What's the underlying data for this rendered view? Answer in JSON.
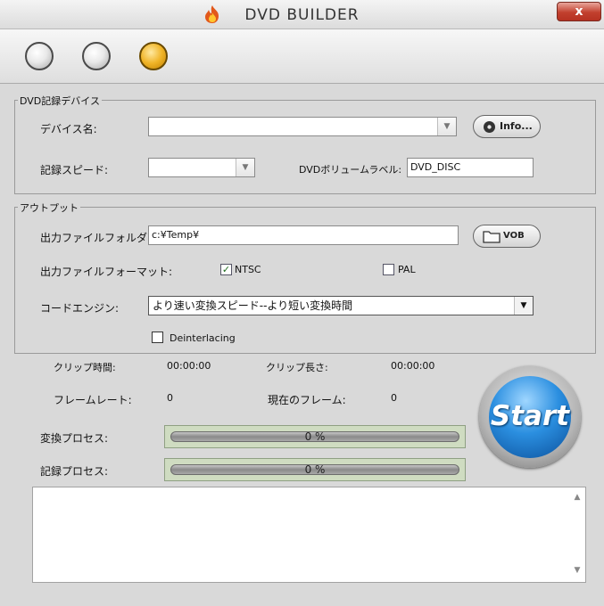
{
  "window": {
    "title": "DVD BUILDER",
    "close_label": "x"
  },
  "toolbar": {
    "circles": [
      {
        "state": "inactive"
      },
      {
        "state": "inactive"
      },
      {
        "state": "active"
      }
    ]
  },
  "dvd_device": {
    "group_label": "DVD記録デバイス",
    "device_name_label": "デバイス名:",
    "device_name_value": "",
    "info_button_label": "Info...",
    "record_speed_label": "記録スピード:",
    "record_speed_value": "",
    "volume_label_label": "DVDボリュームラベル:",
    "volume_label_value": "DVD_DISC"
  },
  "output": {
    "group_label": "アウトプット",
    "output_folder_label": "出力ファイルフォルダ:",
    "output_folder_value": "c:¥Temp¥",
    "vob_button_label": "VOB",
    "output_format_label": "出力ファイルフォーマット:",
    "ntsc_label": "NTSC",
    "ntsc_checked": true,
    "pal_label": "PAL",
    "pal_checked": false,
    "code_engine_label": "コードエンジン:",
    "code_engine_value": "より速い変換スピード--より短い変換時間",
    "deinterlacing_label": "Deinterlacing",
    "deinterlacing_checked": false
  },
  "status": {
    "clip_time_label": "クリップ時間:",
    "clip_time_value": "00:00:00",
    "clip_length_label": "クリップ長さ:",
    "clip_length_value": "00:00:00",
    "frame_rate_label": "フレームレート:",
    "frame_rate_value": "0",
    "current_frame_label": "現在のフレーム:",
    "current_frame_value": "0",
    "convert_process_label": "変換プロセス:",
    "convert_process_percent": "0 %",
    "record_process_label": "記録プロセス:",
    "record_process_percent": "0 %"
  },
  "start_button_label": "Start",
  "log": {
    "text": ""
  },
  "colors": {
    "start_blue": "#2b8fe0",
    "active_circle": "#f0b427",
    "close_red": "#c2402e",
    "progress_bg": "#cfdcc1"
  },
  "icons": [
    "flame-icon",
    "close-icon",
    "disc-icon",
    "folder-icon",
    "dropdown-arrow-icon",
    "checkmark-icon",
    "scroll-up-icon",
    "scroll-down-icon"
  ]
}
